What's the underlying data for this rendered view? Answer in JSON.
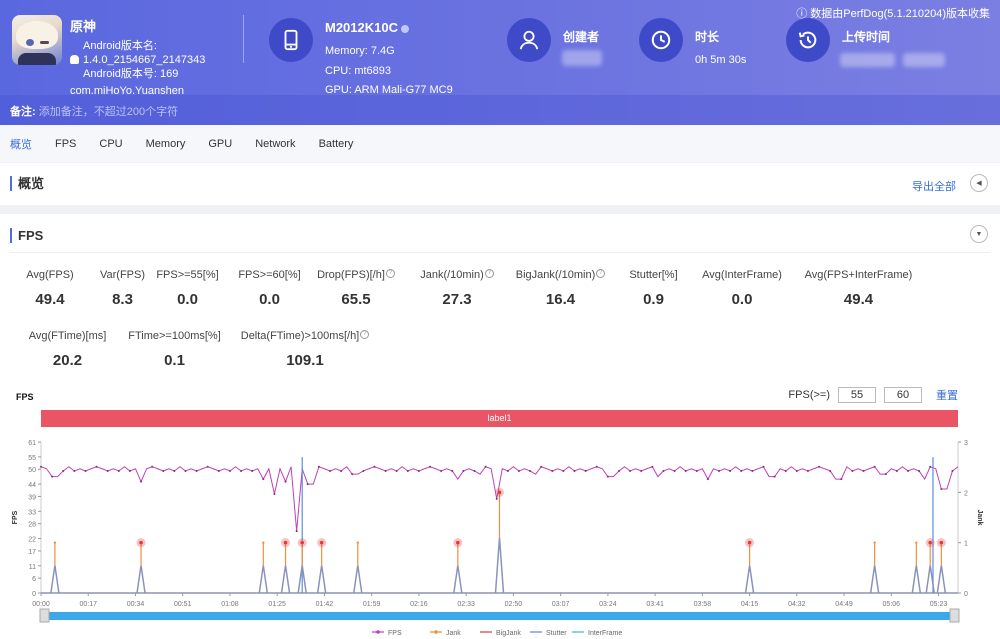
{
  "header": {
    "app": {
      "name": "原神",
      "version_name_label": "Android版本名:",
      "version_name": "1.4.0_2154667_2147343",
      "version_code_label": "Android版本号: 169",
      "package": "com.miHoYo.Yuanshen"
    },
    "device": {
      "model": "M2012K10C",
      "memory": "Memory: 7.4G",
      "cpu": "CPU: mt6893",
      "gpu": "GPU: ARM Mali-G77 MC9"
    },
    "creator_label": "创建者",
    "duration_label": "时长",
    "duration_value": "0h 5m 30s",
    "upload_label": "上传时间",
    "source_note": "ⓘ 数据由PerfDog(5.1.210204)版本收集",
    "remark_label": "备注:",
    "remark_placeholder": "添加备注，不超过200个字符"
  },
  "tabs": [
    {
      "label": "概览",
      "active": true
    },
    {
      "label": "FPS"
    },
    {
      "label": "CPU"
    },
    {
      "label": "Memory"
    },
    {
      "label": "GPU"
    },
    {
      "label": "Network"
    },
    {
      "label": "Battery"
    }
  ],
  "overview": {
    "title": "概览",
    "export_label": "导出全部"
  },
  "fps_section": {
    "title": "FPS",
    "stats_row1": [
      {
        "label": "Avg(FPS)",
        "value": "49.4"
      },
      {
        "label": "Var(FPS)",
        "value": "8.3"
      },
      {
        "label": "FPS>=55[%]",
        "value": "0.0"
      },
      {
        "label": "FPS>=60[%]",
        "value": "0.0"
      },
      {
        "label": "Drop(FPS)[/h]",
        "value": "65.5",
        "help": true
      },
      {
        "label": "Jank(/10min)",
        "value": "27.3",
        "help": true
      },
      {
        "label": "BigJank(/10min)",
        "value": "16.4",
        "help": true
      },
      {
        "label": "Stutter[%]",
        "value": "0.9"
      },
      {
        "label": "Avg(InterFrame)",
        "value": "0.0"
      },
      {
        "label": "Avg(FPS+InterFrame)",
        "value": "49.4"
      }
    ],
    "stats_row2": [
      {
        "label": "Avg(FTime)[ms]",
        "value": "20.2"
      },
      {
        "label": "FTime>=100ms[%]",
        "value": "0.1"
      },
      {
        "label": "Delta(FTime)>100ms[/h]",
        "value": "109.1",
        "help": true
      }
    ],
    "chart_title": "FPS",
    "threshold_label": "FPS(>=)",
    "threshold_low": "55",
    "threshold_high": "60",
    "reset_label": "重置",
    "label_bar": "label1"
  },
  "chart_data": {
    "type": "line",
    "title": "FPS",
    "xlabel": "",
    "ylabel": "FPS",
    "y2label": "Jank",
    "x_tick_labels": [
      "00:00",
      "00:17",
      "00:34",
      "00:51",
      "01:08",
      "01:25",
      "01:42",
      "01:59",
      "02:16",
      "02:33",
      "02:50",
      "03:07",
      "03:24",
      "03:41",
      "03:58",
      "04:15",
      "04:32",
      "04:49",
      "05:06",
      "05:23"
    ],
    "y_ticks": [
      0,
      6,
      11,
      17,
      22,
      28,
      33,
      39,
      44,
      50,
      55,
      61
    ],
    "ylim": [
      0,
      61
    ],
    "y2_ticks": [
      0,
      1,
      2,
      3
    ],
    "y2lim": [
      0,
      3
    ],
    "duration_seconds": 330,
    "fps_baseline": 50,
    "fps_dips": [
      {
        "t": 5,
        "v": 47
      },
      {
        "t": 36,
        "v": 45
      },
      {
        "t": 80,
        "v": 46
      },
      {
        "t": 84,
        "v": 40
      },
      {
        "t": 88,
        "v": 45
      },
      {
        "t": 92,
        "v": 25
      },
      {
        "t": 97,
        "v": 44
      },
      {
        "t": 113,
        "v": 48
      },
      {
        "t": 150,
        "v": 46
      },
      {
        "t": 158,
        "v": 48
      },
      {
        "t": 164,
        "v": 38
      },
      {
        "t": 178,
        "v": 48
      },
      {
        "t": 205,
        "v": 47
      },
      {
        "t": 222,
        "v": 47
      },
      {
        "t": 240,
        "v": 46
      },
      {
        "t": 263,
        "v": 47
      },
      {
        "t": 287,
        "v": 46
      },
      {
        "t": 303,
        "v": 48
      },
      {
        "t": 318,
        "v": 46
      },
      {
        "t": 325,
        "v": 42
      }
    ],
    "jank_events": [
      {
        "t": 5,
        "jank": 1,
        "big": false
      },
      {
        "t": 36,
        "jank": 1,
        "big": true
      },
      {
        "t": 80,
        "jank": 1,
        "big": false
      },
      {
        "t": 88,
        "jank": 1,
        "big": true
      },
      {
        "t": 94,
        "jank": 1,
        "big": true
      },
      {
        "t": 101,
        "jank": 1,
        "big": true
      },
      {
        "t": 114,
        "jank": 1,
        "big": false
      },
      {
        "t": 150,
        "jank": 1,
        "big": true
      },
      {
        "t": 165,
        "jank": 2,
        "big": true
      },
      {
        "t": 255,
        "jank": 1,
        "big": true
      },
      {
        "t": 300,
        "jank": 1,
        "big": false
      },
      {
        "t": 315,
        "jank": 1,
        "big": false
      },
      {
        "t": 320,
        "jank": 1,
        "big": true
      },
      {
        "t": 324,
        "jank": 1,
        "big": true
      }
    ],
    "stutter_spikes": [
      {
        "t": 94,
        "v": 2.7
      },
      {
        "t": 321,
        "v": 2.7
      }
    ],
    "legend": [
      "FPS",
      "Jank",
      "BigJank",
      "Stutter",
      "InterFrame"
    ],
    "legend_position": "bottom-center",
    "colors": {
      "FPS": "#c040b8",
      "Jank": "#f0903a",
      "BigJank": "#e03a3a",
      "Stutter": "#5b8de0",
      "InterFrame": "#3ab8e0",
      "Base": "#8a93b8"
    }
  }
}
